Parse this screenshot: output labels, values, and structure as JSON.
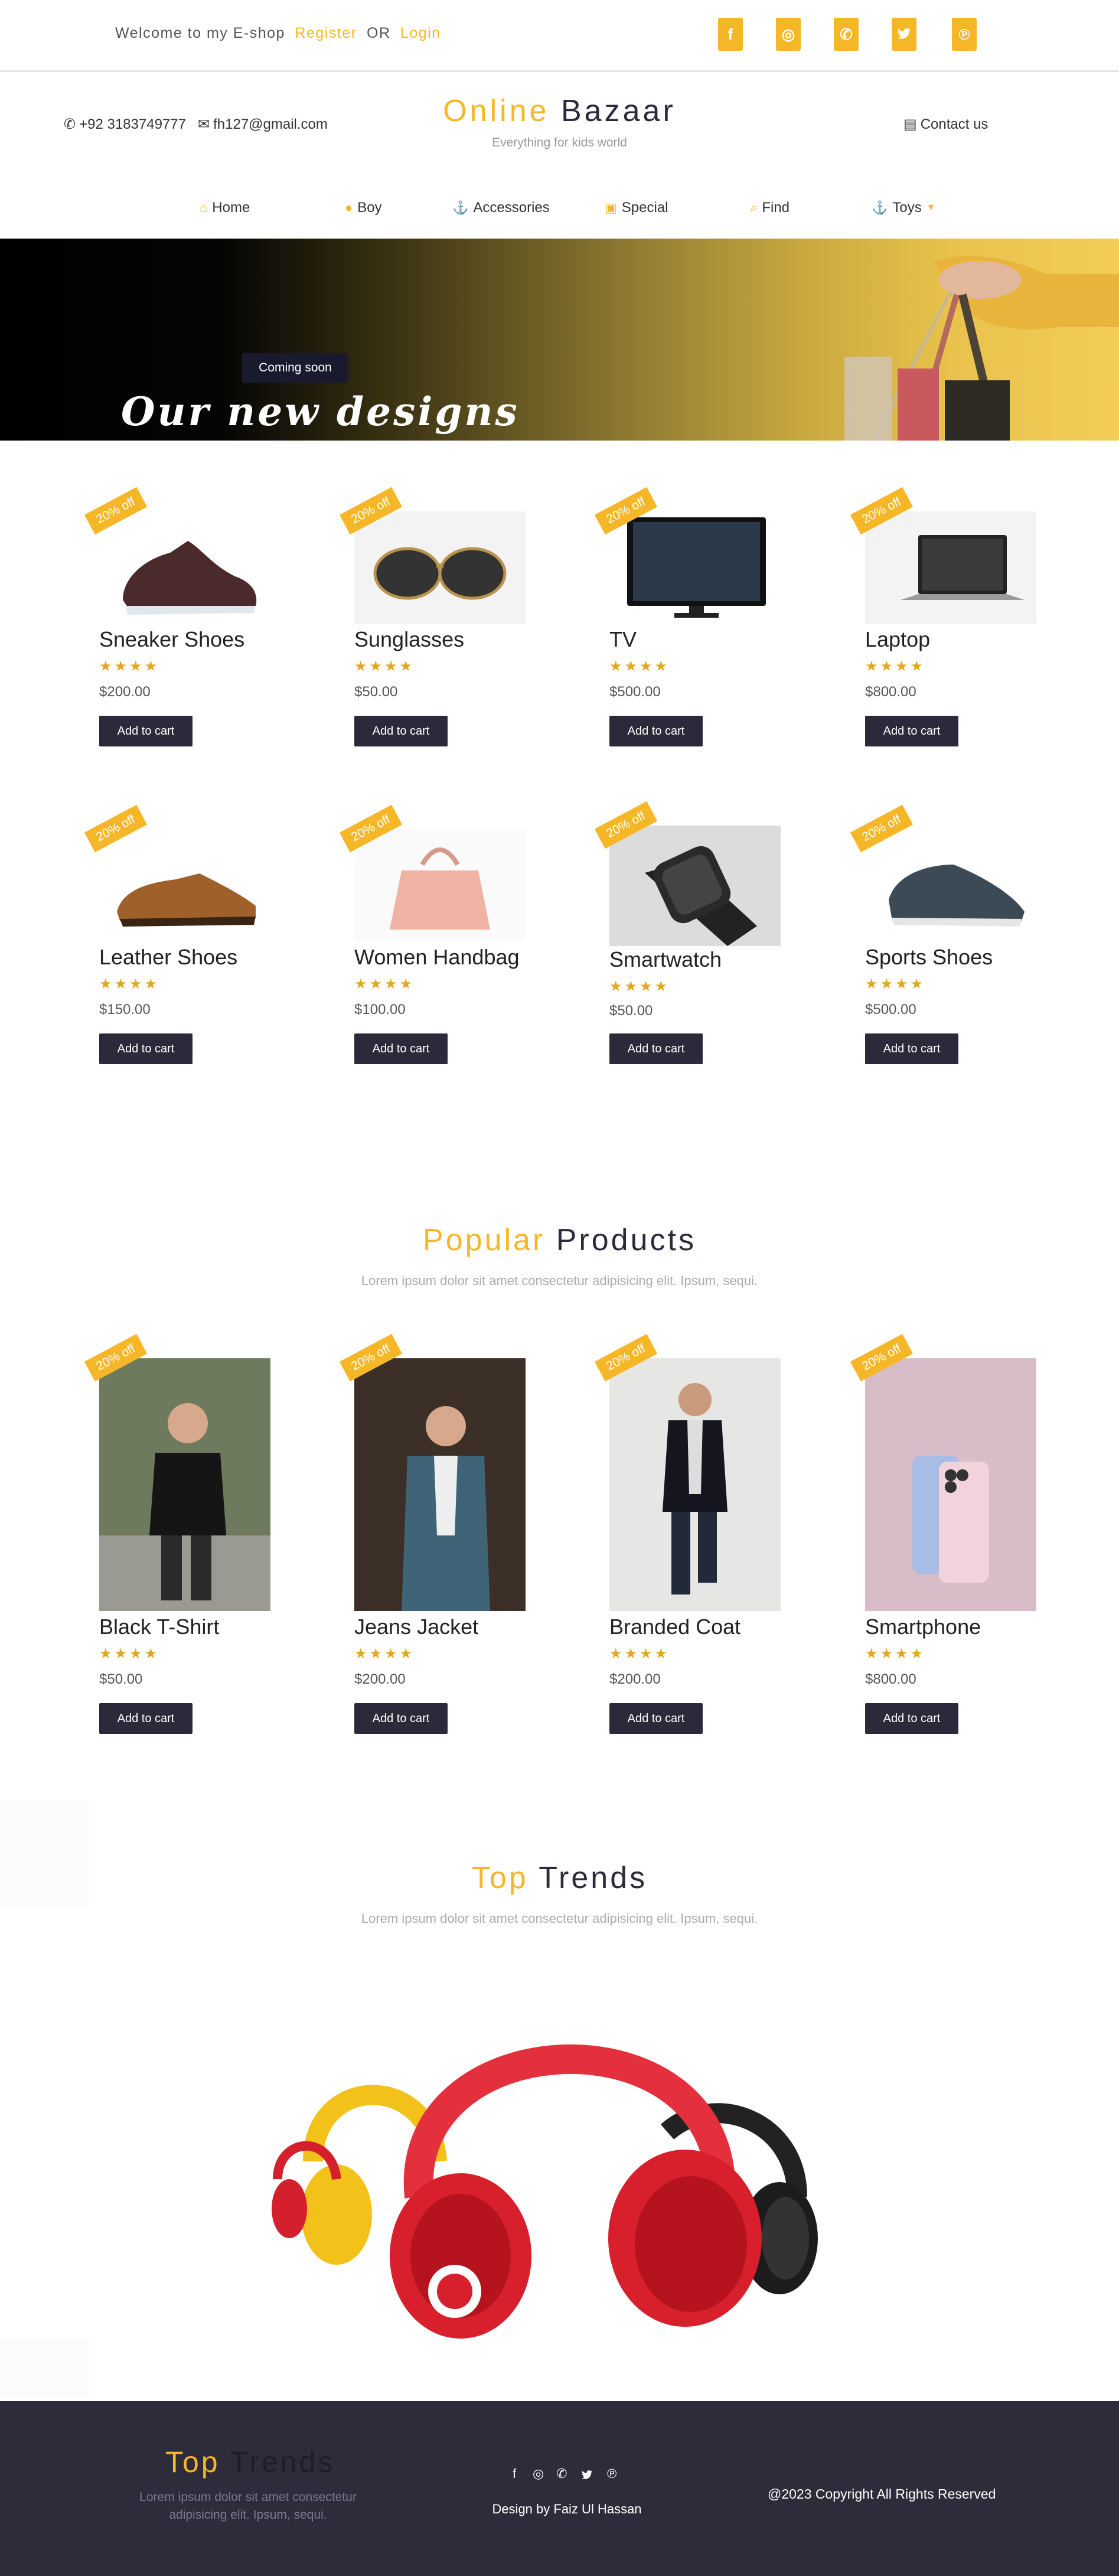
{
  "topbar": {
    "welcome": "Welcome to my E-shop",
    "register": "Register",
    "or": "OR",
    "login": "Login",
    "social": [
      {
        "icon": "facebook-icon",
        "glyph": "f"
      },
      {
        "icon": "instagram-icon",
        "glyph": "◎"
      },
      {
        "icon": "whatsapp-icon",
        "glyph": "✆"
      },
      {
        "icon": "twitter-icon",
        "glyph": "🐦"
      },
      {
        "icon": "pinterest-icon",
        "glyph": "℗"
      }
    ]
  },
  "header": {
    "phone": "+92 3183749777",
    "email": "fh127@gmail.com",
    "logo_accent": "Online",
    "logo_rest": "Bazaar",
    "tagline": "Everything for kids world",
    "contact": "Contact us"
  },
  "nav": [
    {
      "label": "Home",
      "icon": "home-icon",
      "glyph": "⌂"
    },
    {
      "label": "Boy",
      "icon": "user-icon",
      "glyph": "👤"
    },
    {
      "label": "Accessories",
      "icon": "anchor-icon",
      "glyph": "⚓"
    },
    {
      "label": "Special",
      "icon": "calendar-icon",
      "glyph": "▣"
    },
    {
      "label": "Find",
      "icon": "search-icon",
      "glyph": "⌕"
    },
    {
      "label": "Toys",
      "icon": "anchor-icon",
      "glyph": "⚓"
    }
  ],
  "hero": {
    "badge": "Coming soon",
    "title": "Our new designs"
  },
  "ribbon": "20% off",
  "add_to_cart": "Add to cart",
  "stars": "★★★★",
  "products_row1": [
    {
      "name": "Sneaker Shoes",
      "price": "$200.00"
    },
    {
      "name": "Sunglasses",
      "price": "$50.00"
    },
    {
      "name": "TV",
      "price": "$500.00"
    },
    {
      "name": "Laptop",
      "price": "$800.00"
    }
  ],
  "products_row2": [
    {
      "name": "Leather Shoes",
      "price": "$150.00"
    },
    {
      "name": "Women Handbag",
      "price": "$100.00"
    },
    {
      "name": "Smartwatch",
      "price": "$50.00"
    },
    {
      "name": "Sports Shoes",
      "price": "$500.00"
    }
  ],
  "popular": {
    "title_accent": "Popular",
    "title_rest": "Products",
    "subtitle": "Lorem ipsum dolor sit amet consectetur adipisicing elit. Ipsum, sequi.",
    "products": [
      {
        "name": "Black T-Shirt",
        "price": "$50.00"
      },
      {
        "name": "Jeans Jacket",
        "price": "$200.00"
      },
      {
        "name": "Branded Coat",
        "price": "$200.00"
      },
      {
        "name": "Smartphone",
        "price": "$800.00"
      }
    ]
  },
  "trends": {
    "title_accent": "Top",
    "title_rest": "Trends",
    "subtitle": "Lorem ipsum dolor sit amet consectetur adipisicing elit. Ipsum, sequi."
  },
  "footer": {
    "title_accent": "Top",
    "title_rest": "Trends",
    "text": "Lorem ipsum dolor sit amet consectetur adipisicing elit. Ipsum, sequi.",
    "design": "Design by Faiz Ul Hassan",
    "copyright": "@2023 Copyright All Rights Reserved"
  },
  "colors": {
    "accent": "#f5b727",
    "dark": "#2c2a3a",
    "footer": "#2e2b3b"
  }
}
